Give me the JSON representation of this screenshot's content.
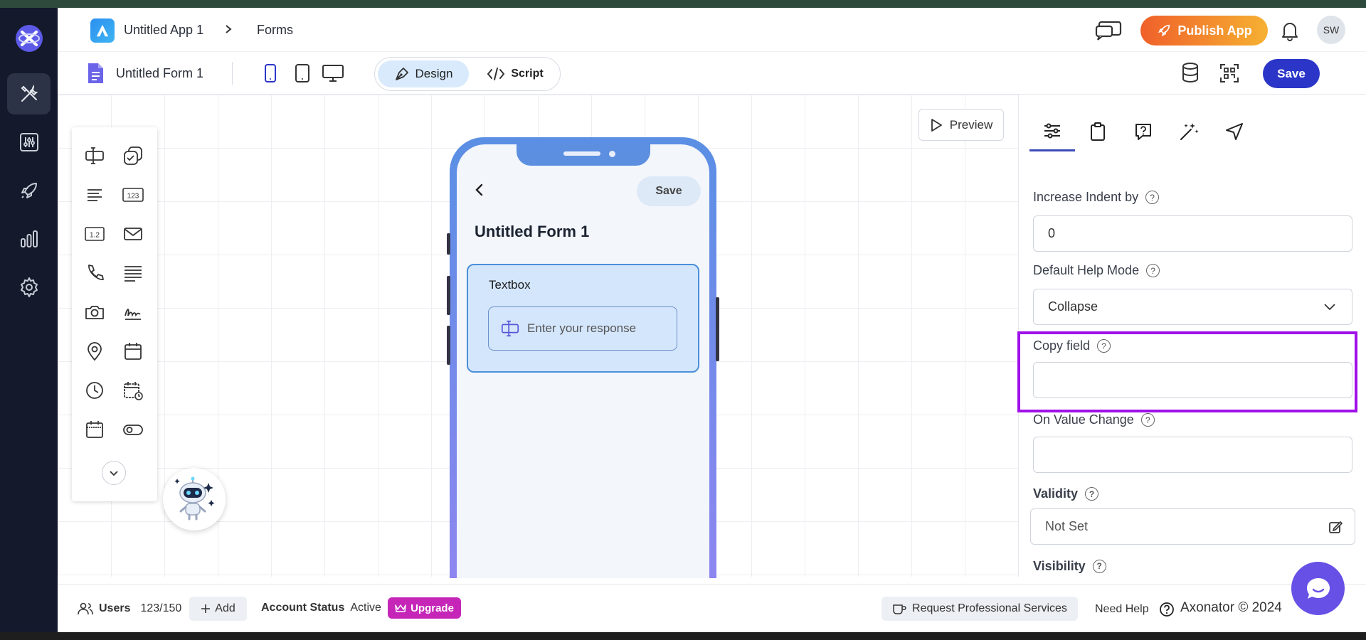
{
  "header": {
    "app_name": "Untitled App 1",
    "section": "Forms",
    "publish_label": "Publish App",
    "avatar_initials": "SW"
  },
  "subheader": {
    "form_name": "Untitled Form 1",
    "design_label": "Design",
    "script_label": "Script",
    "save_label": "Save"
  },
  "canvas": {
    "preview_label": "Preview"
  },
  "phone": {
    "save_label": "Save",
    "form_title": "Untitled Form 1",
    "field_label": "Textbox",
    "field_placeholder": "Enter your response"
  },
  "properties": {
    "increase_indent_label": "Increase Indent by",
    "increase_indent_value": "0",
    "help_mode_label": "Default Help Mode",
    "help_mode_value": "Collapse",
    "copy_field_label": "Copy field",
    "copy_field_value": "",
    "on_value_change_label": "On Value Change",
    "on_value_change_value": "",
    "validity_label": "Validity",
    "validity_value": "Not Set",
    "visibility_label": "Visibility"
  },
  "footer": {
    "users_label": "Users",
    "users_count": "123/150",
    "add_label": "Add",
    "account_status_label": "Account Status",
    "account_status_value": "Active",
    "upgrade_label": "Upgrade",
    "request_services_label": "Request Professional Services",
    "need_help_label": "Need Help",
    "copyright": "Axonator © 2024"
  },
  "colors": {
    "accent": "#2b36c8",
    "highlight": "#a010e8",
    "nav_bg": "#14192b"
  }
}
